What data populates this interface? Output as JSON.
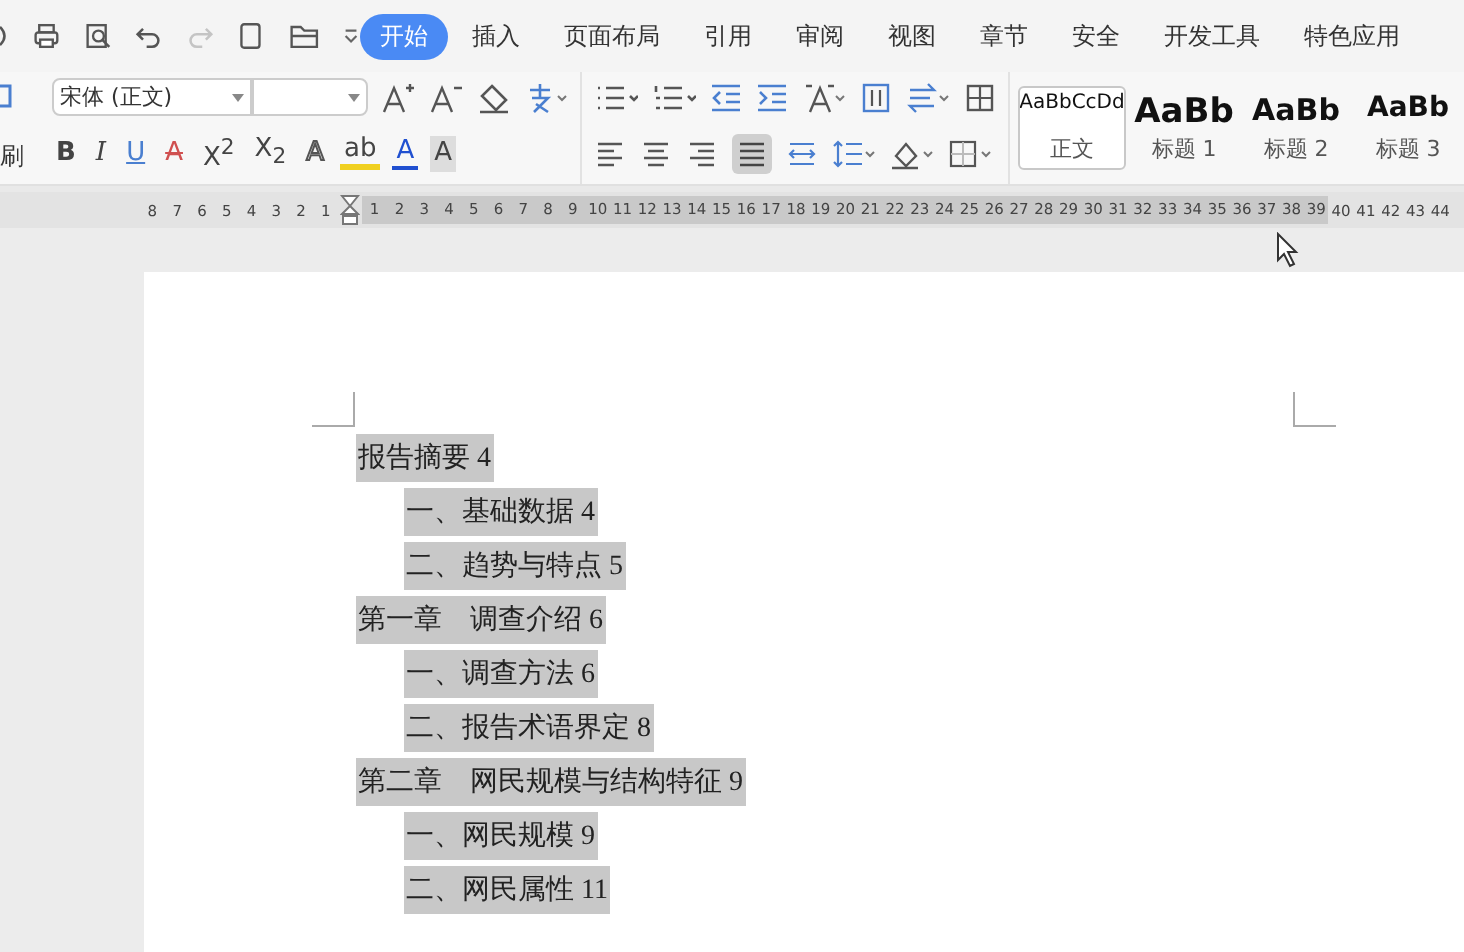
{
  "menu_tabs": [
    {
      "label": "开始",
      "selected": true
    },
    {
      "label": "插入",
      "selected": false
    },
    {
      "label": "页面布局",
      "selected": false
    },
    {
      "label": "引用",
      "selected": false
    },
    {
      "label": "审阅",
      "selected": false
    },
    {
      "label": "视图",
      "selected": false
    },
    {
      "label": "章节",
      "selected": false
    },
    {
      "label": "安全",
      "selected": false
    },
    {
      "label": "开发工具",
      "selected": false
    },
    {
      "label": "特色应用",
      "selected": false
    }
  ],
  "quick_access": {
    "redo_disabled": true
  },
  "ribbon": {
    "format_painter_label": "刷",
    "font_name": "宋体 (正文)",
    "font_buttons": [
      {
        "label": "B",
        "kind": "bold"
      },
      {
        "label": "I",
        "kind": "italic"
      },
      {
        "label": "U",
        "kind": "underline"
      },
      {
        "label": "A",
        "kind": "strike"
      },
      {
        "label": "X$^{2}$",
        "kind": "plain"
      },
      {
        "label": "X$_{2}$",
        "kind": "plain"
      },
      {
        "label": "A",
        "kind": "outline"
      },
      {
        "label": "ab",
        "kind": "highlight"
      },
      {
        "label": "A",
        "kind": "fontcolor"
      },
      {
        "label": "A",
        "kind": "shaded"
      }
    ],
    "styles": [
      {
        "preview": "AaBbCcDd",
        "name": "正文",
        "kind": "body",
        "selected": true
      },
      {
        "preview": "AaBb",
        "name": "标题 1",
        "kind": "h1",
        "selected": false
      },
      {
        "preview": "AaBb",
        "name": "标题 2",
        "kind": "h2",
        "selected": false
      },
      {
        "preview": "AaBb",
        "name": "标题 3",
        "kind": "h3",
        "selected": false
      }
    ]
  },
  "ruler": {
    "left_numbers": [
      "8",
      "7",
      "6",
      "5",
      "4",
      "3",
      "2",
      "1"
    ],
    "right_numbers": [
      "1",
      "2",
      "3",
      "4",
      "5",
      "6",
      "7",
      "8",
      "9",
      "10",
      "11",
      "12",
      "13",
      "14",
      "15",
      "16",
      "17",
      "18",
      "19",
      "20",
      "21",
      "22",
      "23",
      "24",
      "25",
      "26",
      "27",
      "28",
      "29",
      "30",
      "31",
      "32",
      "33",
      "34",
      "35",
      "36",
      "37",
      "38",
      "39",
      "40",
      "41",
      "42",
      "43",
      "44"
    ]
  },
  "document": {
    "highlighted": true,
    "toc": [
      {
        "text": "报告摘要 4",
        "children": [
          {
            "text": "一、基础数据 4"
          },
          {
            "text": "二、趋势与特点 5"
          }
        ]
      },
      {
        "text": "第一章　调查介绍 6",
        "children": [
          {
            "text": "一、调查方法 6"
          },
          {
            "text": "二、报告术语界定 8"
          }
        ]
      },
      {
        "text": "第二章　网民规模与结构特征 9",
        "children": [
          {
            "text": "一、网民规模 9"
          },
          {
            "text": "二、网民属性 11"
          }
        ]
      }
    ]
  }
}
